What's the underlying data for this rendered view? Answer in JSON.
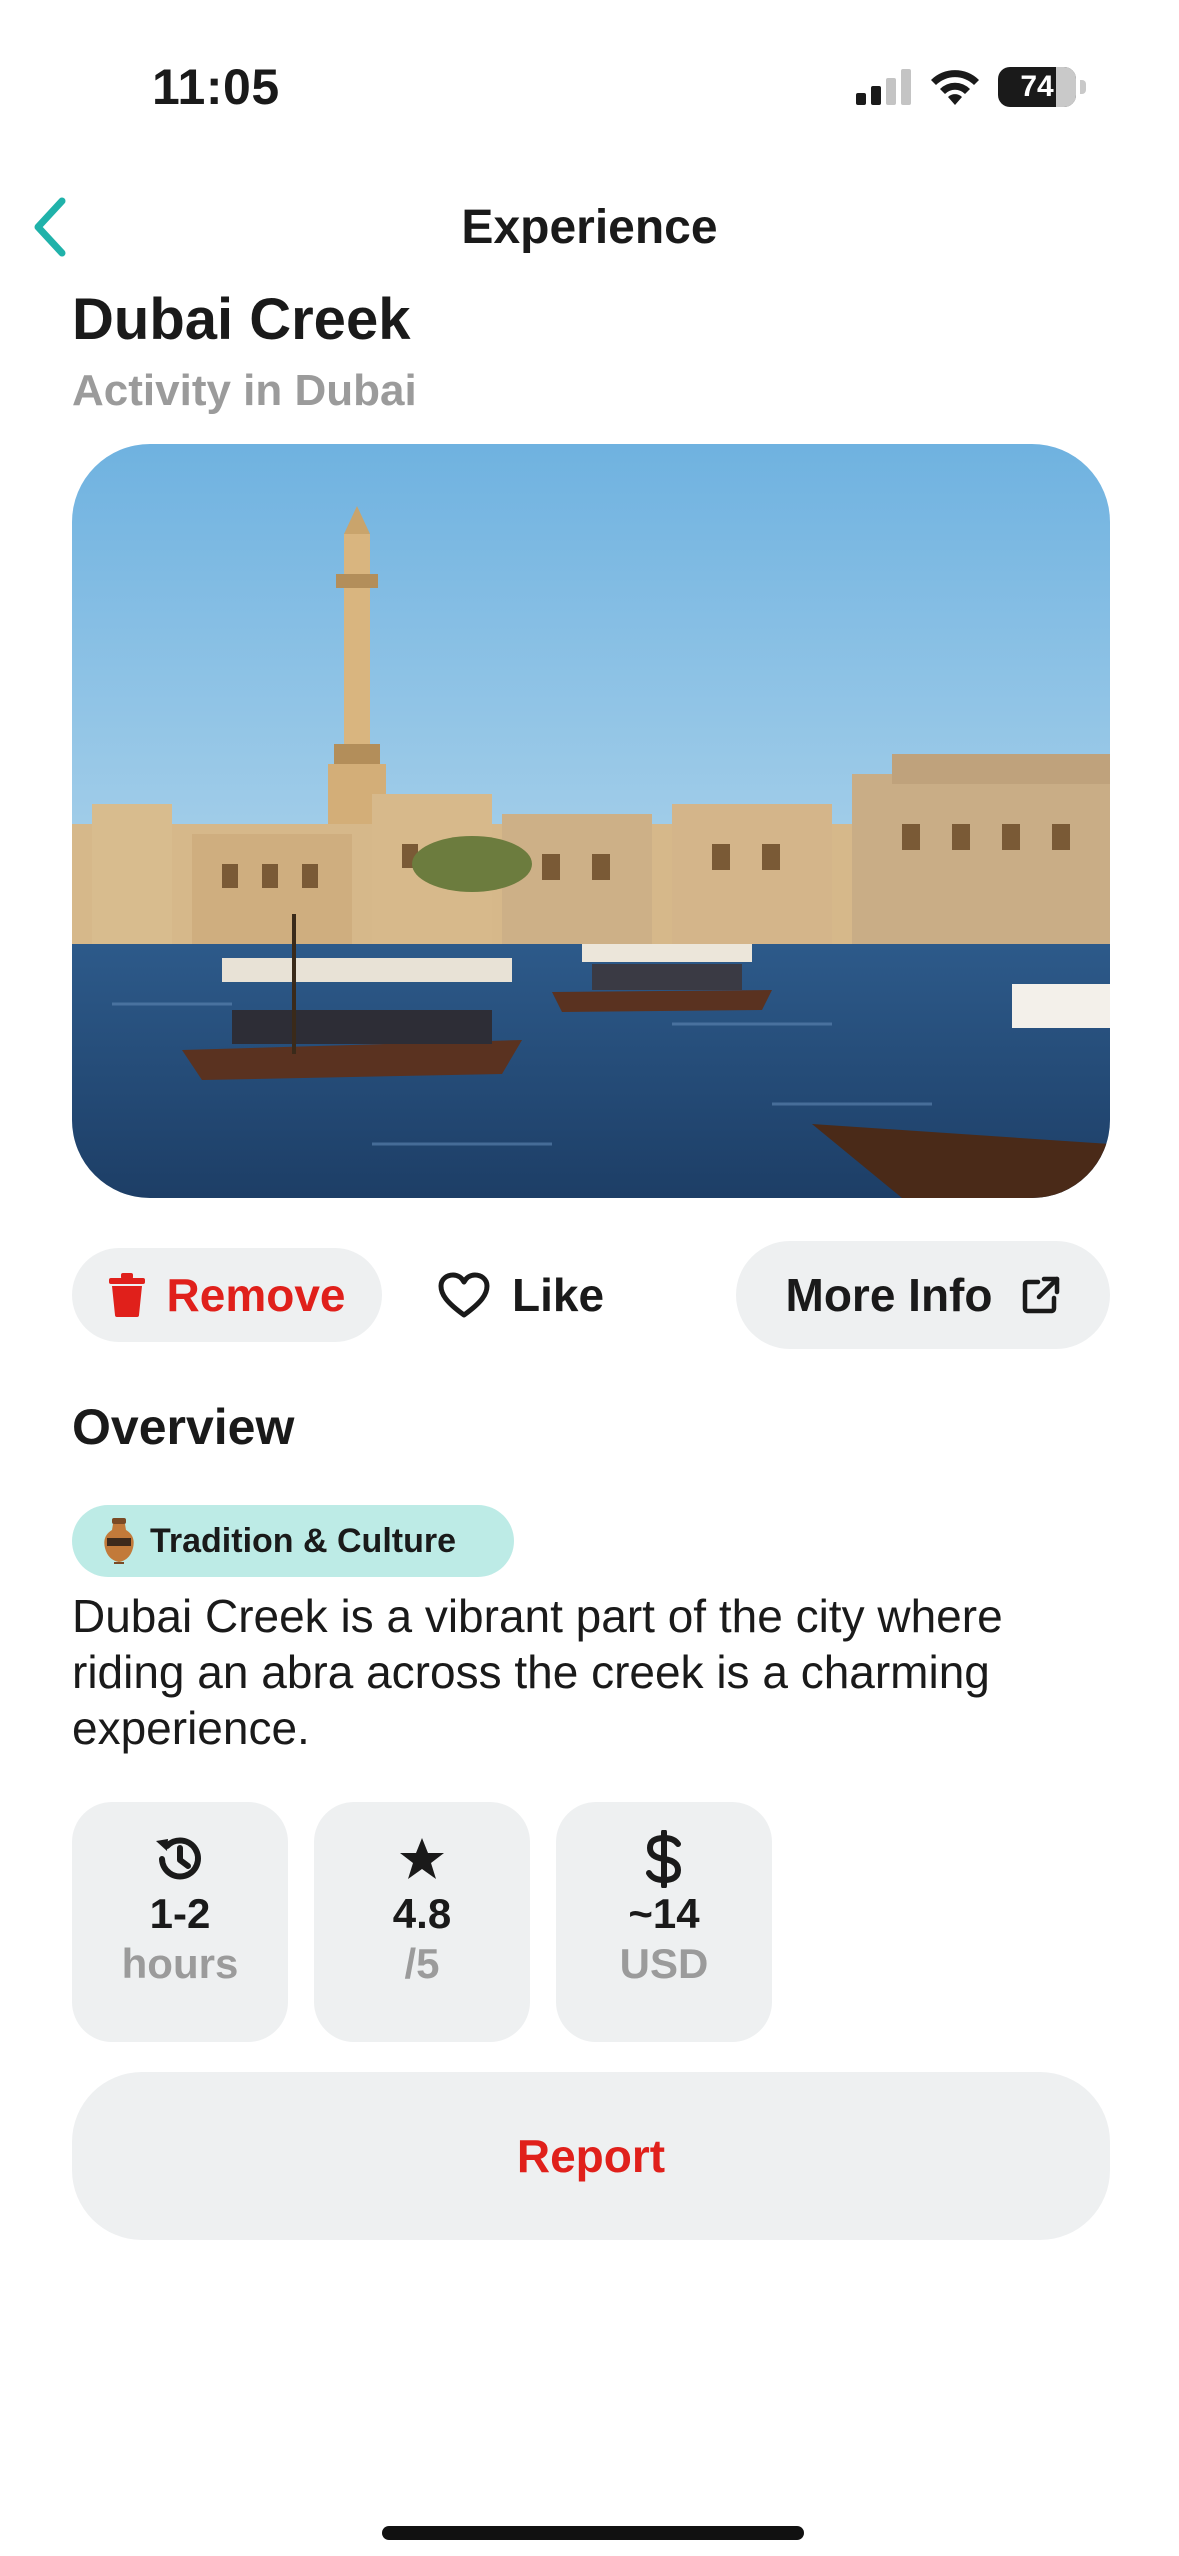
{
  "status_bar": {
    "time": "11:05",
    "battery": "74"
  },
  "nav": {
    "title": "Experience",
    "back_icon": "chevron-left-icon"
  },
  "header": {
    "title": "Dubai Creek",
    "subtitle": "Activity in Dubai"
  },
  "actions": {
    "remove_label": "Remove",
    "like_label": "Like",
    "more_info_label": "More Info"
  },
  "overview": {
    "heading": "Overview",
    "tag": "Tradition & Culture",
    "description": "Dubai Creek is a vibrant part of the city where riding an abra across the creek is a charming experience."
  },
  "stats": [
    {
      "icon": "history-icon",
      "value": "1-2",
      "unit": "hours"
    },
    {
      "icon": "star-icon",
      "value": "4.8",
      "unit": "/5"
    },
    {
      "icon": "dollar-icon",
      "value": "~14",
      "unit": "USD"
    }
  ],
  "report_label": "Report",
  "colors": {
    "accent": "#20b2aa",
    "danger": "#e0201b",
    "tag_bg": "#bdebe6",
    "chip_bg": "#eef0f1",
    "muted_text": "#9b9b9b"
  }
}
